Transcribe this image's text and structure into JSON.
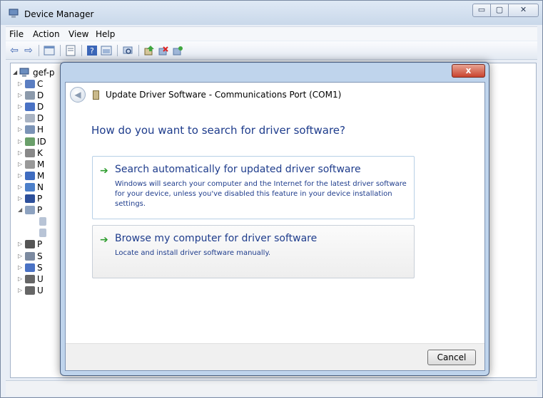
{
  "window": {
    "title": "Device Manager",
    "controls": {
      "minimize": "▭",
      "maximize": "▢",
      "close": "✕"
    }
  },
  "menu": [
    "File",
    "Action",
    "View",
    "Help"
  ],
  "toolbar": {
    "icons": [
      "back-arrow-icon",
      "forward-arrow-icon",
      "show-hide-console-tree-icon",
      "properties-icon",
      "help-icon",
      "view-icon",
      "scan-hardware-icon",
      "update-driver-icon",
      "uninstall-icon",
      "disable-icon"
    ]
  },
  "tree": {
    "root_label": "gef-p",
    "items": [
      {
        "letter": "C",
        "icon": "computer-icon"
      },
      {
        "letter": "D",
        "icon": "disk-drive-icon"
      },
      {
        "letter": "D",
        "icon": "display-adapter-icon"
      },
      {
        "letter": "D",
        "icon": "dvd-drive-icon"
      },
      {
        "letter": "H",
        "icon": "hid-icon"
      },
      {
        "letter": "ID",
        "icon": "ide-controller-icon"
      },
      {
        "letter": "K",
        "icon": "keyboard-icon"
      },
      {
        "letter": "M",
        "icon": "mouse-icon"
      },
      {
        "letter": "M",
        "icon": "monitor-icon"
      },
      {
        "letter": "N",
        "icon": "network-adapter-icon"
      },
      {
        "letter": "P",
        "icon": "port-icon"
      },
      {
        "letter": "P",
        "icon": "ports-icon"
      },
      {
        "letter": "",
        "icon": "port-child-icon"
      },
      {
        "letter": "",
        "icon": "port-child-icon"
      },
      {
        "letter": "P",
        "icon": "processor-icon"
      },
      {
        "letter": "S",
        "icon": "sound-icon"
      },
      {
        "letter": "S",
        "icon": "system-device-icon"
      },
      {
        "letter": "U",
        "icon": "usb-icon"
      },
      {
        "letter": "U",
        "icon": "usb-icon"
      }
    ]
  },
  "dialog": {
    "title": "Update Driver Software - Communications Port (COM1)",
    "close_label": "x",
    "question": "How do you want to search for driver software?",
    "option_auto": {
      "title": "Search automatically for updated driver software",
      "description": "Windows will search your computer and the Internet for the latest driver software for your device, unless you've disabled this feature in your device installation settings."
    },
    "option_browse": {
      "title": "Browse my computer for driver software",
      "description": "Locate and install driver software manually."
    },
    "cancel_label": "Cancel"
  },
  "colors": {
    "link_blue": "#1e3c8c",
    "arrow_green": "#2e9d2e",
    "close_red": "#c9432e"
  }
}
